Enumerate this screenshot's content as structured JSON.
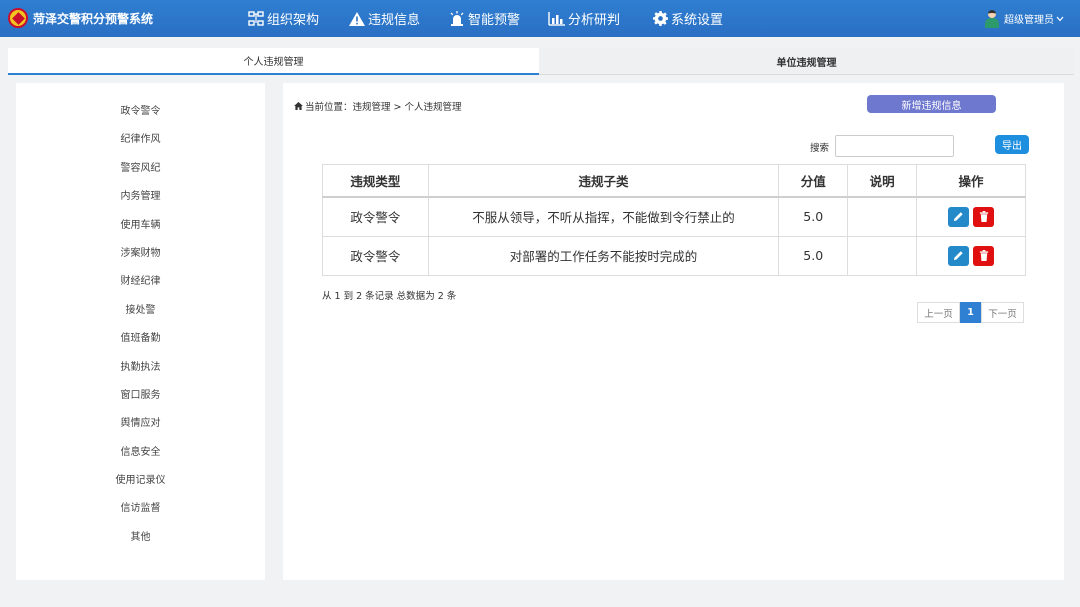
{
  "app": {
    "title": "菏泽交警积分预警系统"
  },
  "nav": [
    {
      "label": "组织架构",
      "icon": "org-structure-icon"
    },
    {
      "label": "违规信息",
      "icon": "warning-icon"
    },
    {
      "label": "智能预警",
      "icon": "alarm-light-icon"
    },
    {
      "label": "分析研判",
      "icon": "bar-chart-icon"
    },
    {
      "label": "系统设置",
      "icon": "gear-icon"
    }
  ],
  "user": {
    "name": "超级管理员"
  },
  "tabs": [
    {
      "label": "个人违规管理"
    },
    {
      "label": "单位违规管理"
    }
  ],
  "sidebar": {
    "items": [
      {
        "label": "政令警令"
      },
      {
        "label": "纪律作风"
      },
      {
        "label": "警容风纪"
      },
      {
        "label": "内务管理"
      },
      {
        "label": "使用车辆"
      },
      {
        "label": "涉案财物"
      },
      {
        "label": "财经纪律"
      },
      {
        "label": "接处警"
      },
      {
        "label": "值班备勤"
      },
      {
        "label": "执勤执法"
      },
      {
        "label": "窗口服务"
      },
      {
        "label": "舆情应对"
      },
      {
        "label": "信息安全"
      },
      {
        "label": "使用记录仪"
      },
      {
        "label": "信访监督"
      },
      {
        "label": "其他"
      }
    ]
  },
  "main": {
    "breadcrumb": "当前位置：违规管理 > 个人违规管理",
    "add_button": "新增违规信息",
    "search_label": "搜索",
    "search_value": "",
    "export_button": "导出",
    "table": {
      "headers": [
        "违规类型",
        "违规子类",
        "分值",
        "说明",
        "操作"
      ],
      "rows": [
        {
          "type": "政令警令",
          "subtype": "不服从领导，不听从指挥，不能做到令行禁止的",
          "score": "5.0",
          "note": ""
        },
        {
          "type": "政令警令",
          "subtype": "对部署的工作任务不能按时完成的",
          "score": "5.0",
          "note": ""
        }
      ]
    },
    "summary": "从 1 到 2 条记录 总数据为 2 条",
    "pager": {
      "prev": "上一页",
      "current": "1",
      "next": "下一页"
    }
  },
  "colors": {
    "topbar": "#2f7fd2",
    "add_button": "#6f78cf",
    "export_button": "#1e8fdf",
    "edit_button": "#2389c9",
    "delete_button": "#e01010"
  }
}
